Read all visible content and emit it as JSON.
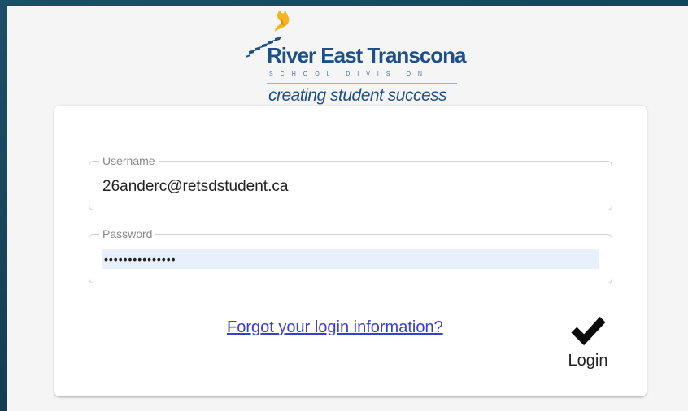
{
  "brand": {
    "name": "River East Transcona",
    "subtitle": "SCHOOL DIVISION",
    "tagline": "creating student success",
    "colors": {
      "primary": "#1e4f86",
      "flame": "#f2b51c"
    }
  },
  "form": {
    "username": {
      "label": "Username",
      "value": "26anderc@retsdstudent.ca"
    },
    "password": {
      "label": "Password",
      "value": "•••••••••••••••"
    },
    "forgot_link": "Forgot your login information?",
    "login_button": {
      "label": "Login",
      "icon": "checkmark-icon"
    }
  }
}
